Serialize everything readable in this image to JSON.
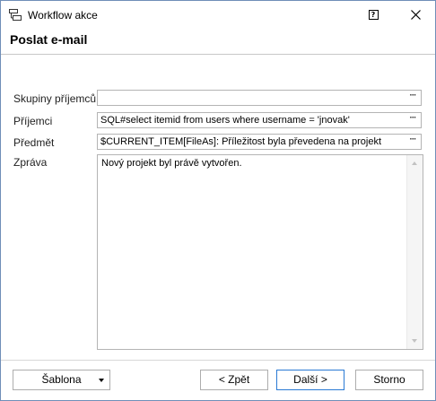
{
  "window": {
    "title": "Workflow akce",
    "help_glyph": "?"
  },
  "header": {
    "title": "Poslat e-mail"
  },
  "form": {
    "recipient_groups": {
      "label": "Skupiny příjemců",
      "value": ""
    },
    "recipients": {
      "label": "Příjemci",
      "value": "SQL#select itemid from users where username = 'jnovak'"
    },
    "subject": {
      "label": "Předmět",
      "value": "$CURRENT_ITEM[FileAs]: Příležitost byla převedena na projekt"
    },
    "message": {
      "label": "Zpráva",
      "value": "Nový projekt byl právě vytvořen."
    },
    "picker_glyph": "···"
  },
  "footer": {
    "template_label": "Šablona",
    "back_label": "< Zpět",
    "next_label": "Další >",
    "cancel_label": "Storno"
  },
  "colors": {
    "accent": "#2a7ad4",
    "border": "#6f8eb8"
  }
}
